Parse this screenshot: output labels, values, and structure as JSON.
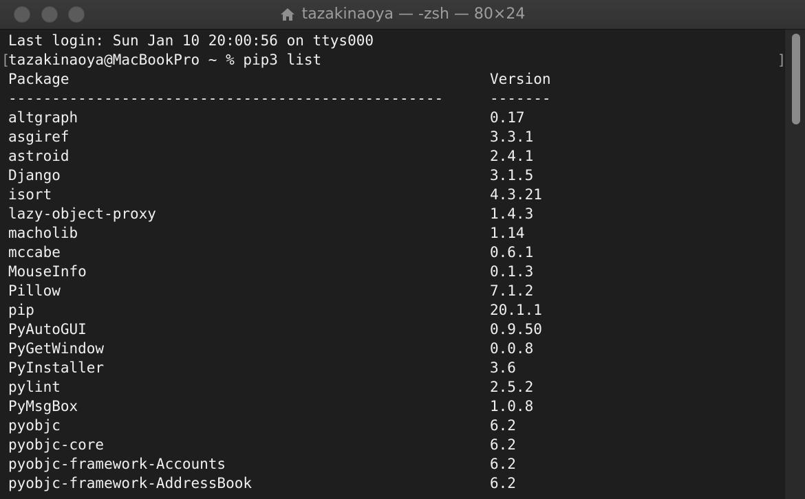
{
  "window": {
    "title": "tazakinaoya — -zsh — 80×24",
    "title_icon": "home-icon"
  },
  "terminal": {
    "login_line": "Last login: Sun Jan 10 20:00:56 on ttys000",
    "prompt_line": "tazakinaoya@MacBookPro ~ % pip3 list",
    "header": {
      "package": "Package",
      "version": "Version"
    },
    "separator": {
      "package": "--------------------------------------------------",
      "version": "-------"
    },
    "rows": [
      {
        "package": "altgraph",
        "version": "0.17"
      },
      {
        "package": "asgiref",
        "version": "3.3.1"
      },
      {
        "package": "astroid",
        "version": "2.4.1"
      },
      {
        "package": "Django",
        "version": "3.1.5"
      },
      {
        "package": "isort",
        "version": "4.3.21"
      },
      {
        "package": "lazy-object-proxy",
        "version": "1.4.3"
      },
      {
        "package": "macholib",
        "version": "1.14"
      },
      {
        "package": "mccabe",
        "version": "0.6.1"
      },
      {
        "package": "MouseInfo",
        "version": "0.1.3"
      },
      {
        "package": "Pillow",
        "version": "7.1.2"
      },
      {
        "package": "pip",
        "version": "20.1.1"
      },
      {
        "package": "PyAutoGUI",
        "version": "0.9.50"
      },
      {
        "package": "PyGetWindow",
        "version": "0.0.8"
      },
      {
        "package": "PyInstaller",
        "version": "3.6"
      },
      {
        "package": "pylint",
        "version": "2.5.2"
      },
      {
        "package": "PyMsgBox",
        "version": "1.0.8"
      },
      {
        "package": "pyobjc",
        "version": "6.2"
      },
      {
        "package": "pyobjc-core",
        "version": "6.2"
      },
      {
        "package": "pyobjc-framework-Accounts",
        "version": "6.2"
      },
      {
        "package": "pyobjc-framework-AddressBook",
        "version": "6.2"
      }
    ]
  }
}
